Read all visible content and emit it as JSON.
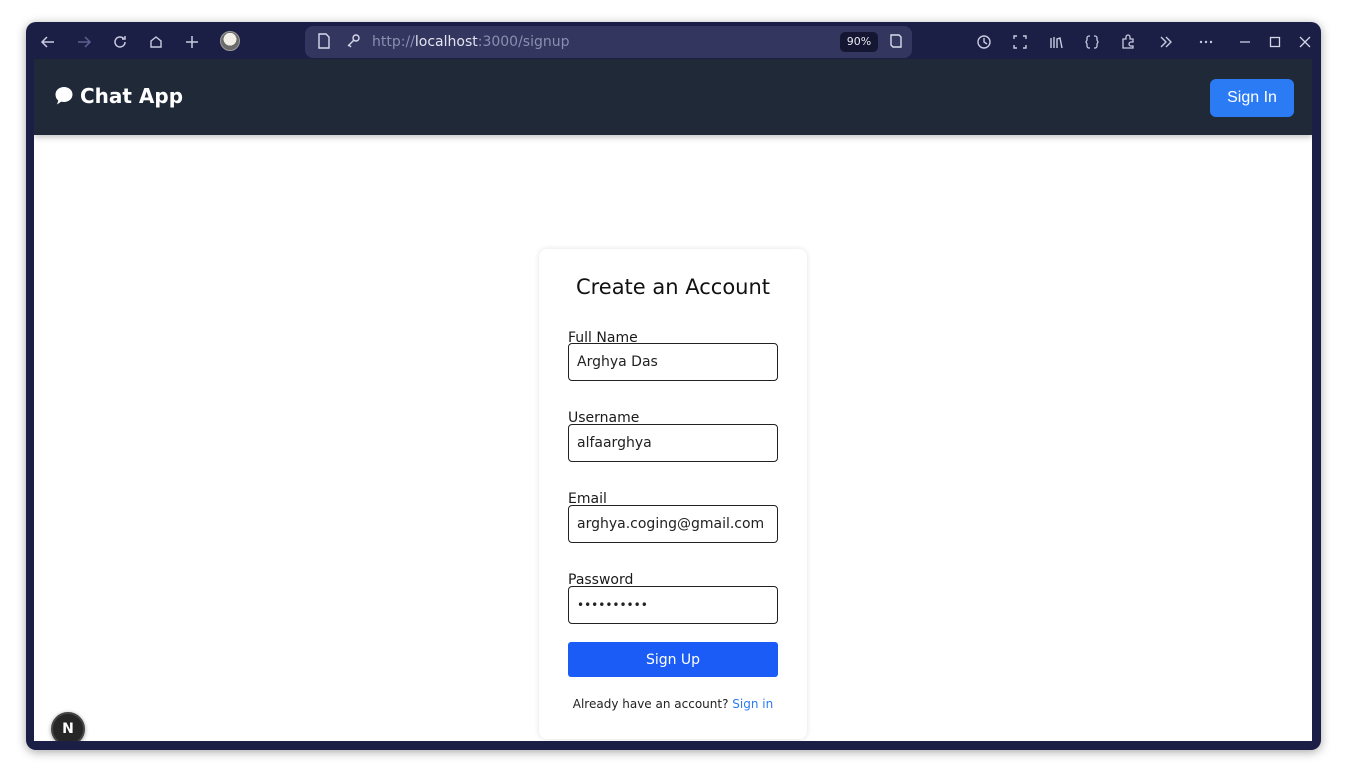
{
  "browser": {
    "url_scheme": "http://",
    "url_host": "localhost",
    "url_path": ":3000/signup",
    "zoom": "90%"
  },
  "navbar": {
    "brand": "Chat App",
    "signin_label": "Sign In"
  },
  "form": {
    "title": "Create an Account",
    "full_name_label": "Full Name",
    "full_name_value": "Arghya Das",
    "username_label": "Username",
    "username_value": "alfaarghya",
    "email_label": "Email",
    "email_value": "arghya.coging@gmail.com",
    "password_label": "Password",
    "password_value": "••••••••••",
    "submit_label": "Sign Up",
    "footer_prompt": "Already have an account?",
    "footer_link": "Sign in"
  },
  "dev_badge": "N",
  "colors": {
    "navbar_bg": "#1f2937",
    "signin_btn": "#2b7bf5",
    "signup_btn": "#1a5cf5",
    "link": "#2b7bf5"
  }
}
